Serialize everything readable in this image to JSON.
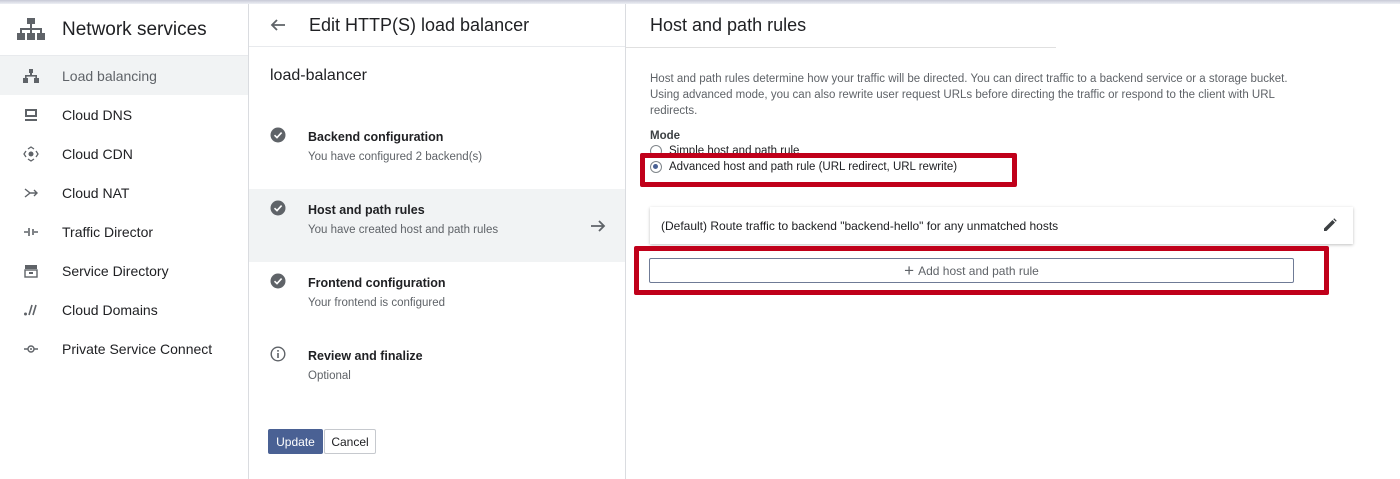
{
  "sidebar": {
    "title": "Network services",
    "title_icon": "network-services-icon",
    "items": [
      {
        "label": "Load balancing",
        "icon": "load-balancing-icon",
        "active": true
      },
      {
        "label": "Cloud DNS",
        "icon": "cloud-dns-icon"
      },
      {
        "label": "Cloud CDN",
        "icon": "cloud-cdn-icon"
      },
      {
        "label": "Cloud NAT",
        "icon": "cloud-nat-icon"
      },
      {
        "label": "Traffic Director",
        "icon": "traffic-director-icon"
      },
      {
        "label": "Service Directory",
        "icon": "service-directory-icon"
      },
      {
        "label": "Cloud Domains",
        "icon": "cloud-domains-icon"
      },
      {
        "label": "Private Service Connect",
        "icon": "private-service-connect-icon"
      }
    ]
  },
  "editor": {
    "title": "Edit HTTP(S) load balancer",
    "lb_name": "load-balancer",
    "steps": [
      {
        "title": "Backend configuration",
        "subtitle": "You have configured 2 backend(s)",
        "icon": "check-circle-icon"
      },
      {
        "title": "Host and path rules",
        "subtitle": "You have created host and path rules",
        "icon": "check-circle-icon",
        "active": true
      },
      {
        "title": "Frontend configuration",
        "subtitle": "Your frontend is configured",
        "icon": "check-circle-icon"
      },
      {
        "title": "Review and finalize",
        "subtitle": "Optional",
        "icon": "info-icon"
      }
    ],
    "update_label": "Update",
    "cancel_label": "Cancel"
  },
  "panel": {
    "title": "Host and path rules",
    "description": "Host and path rules determine how your traffic will be directed. You can direct traffic to a backend service or a storage bucket. Using advanced mode, you can also rewrite user request URLs before directing the traffic or respond to the client with URL redirects.",
    "mode_label": "Mode",
    "mode_options": [
      {
        "label": "Simple host and path rule",
        "selected": false
      },
      {
        "label": "Advanced host and path rule (URL redirect, URL rewrite)",
        "selected": true
      }
    ],
    "default_rule": "(Default) Route traffic to backend \"backend-hello\" for any unmatched hosts",
    "add_rule_label": "Add host and path rule"
  },
  "colors": {
    "accent": "#4a6194",
    "highlight": "#c0001a",
    "active_row": "#f1f3f4"
  }
}
